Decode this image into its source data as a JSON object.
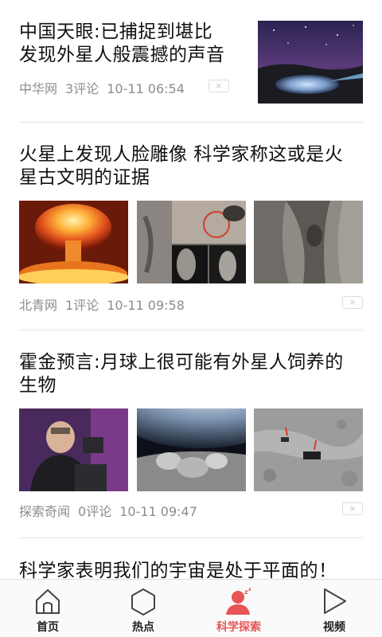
{
  "articles": [
    {
      "title": "中国天眼:已捕捉到堪比发现外星人般震撼的声音",
      "title_lines": [
        "中国天眼:已捕捉到堪比",
        "发现外星人般震撼的声音"
      ],
      "source": "中华网",
      "comments": "3评论",
      "time": "10-11 06:54"
    },
    {
      "title": "火星上发现人脸雕像 科学家称这或是火星古文明的证据",
      "title_lines": [
        "火星上发现人脸雕像 科学家称这或是火",
        "星古文明的证据"
      ],
      "source": "北青网",
      "comments": "1评论",
      "time": "10-11 09:58"
    },
    {
      "title": "霍金预言:月球上很可能有外星人饲养的生物",
      "title_lines": [
        "霍金预言:月球上很可能有外星人饲养的",
        "生物"
      ],
      "source": "探索奇闻",
      "comments": "0评论",
      "time": "10-11 09:47"
    },
    {
      "title": "科学家表明我们的宇宙是处于平面的！",
      "title_lines": [
        "科学家表明我们的宇宙是处于平面的！"
      ]
    }
  ],
  "close_label": "×",
  "tabs": [
    {
      "label": "首页",
      "icon": "home-icon"
    },
    {
      "label": "热点",
      "icon": "hexagon-icon"
    },
    {
      "label": "科学探索",
      "icon": "person-sleep-icon",
      "active": true
    },
    {
      "label": "视频",
      "icon": "play-icon"
    }
  ],
  "colors": {
    "accent": "#e85454",
    "meta_text": "#8c8c8c",
    "divider": "#e4e4e4"
  }
}
